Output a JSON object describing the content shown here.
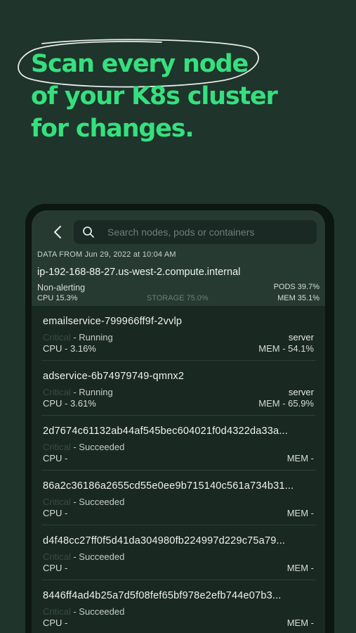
{
  "headline": {
    "line1": "Scan every node",
    "line2": "of your K8s cluster",
    "line3": "for changes."
  },
  "search": {
    "placeholder": "Search nodes, pods or containers"
  },
  "data_from": "DATA FROM Jun 29, 2022 at 10:04 AM",
  "node": {
    "name": "ip-192-168-88-27.us-west-2.compute.internal",
    "state": "Non-alerting",
    "pods": "PODS 39.7%",
    "cpu": "CPU 15.3%",
    "storage": "STORAGE 75.0%",
    "mem": "MEM 35.1%"
  },
  "items": [
    {
      "title": "emailservice-799966ff9f-2vvlp",
      "critical": "Critical",
      "status": " - Running",
      "role": "server",
      "cpu": "CPU - 3.16%",
      "mem": "MEM - 54.1%"
    },
    {
      "title": "adservice-6b74979749-qmnx2",
      "critical": "Critical",
      "status": " - Running",
      "role": "server",
      "cpu": "CPU - 3.61%",
      "mem": "MEM - 65.9%"
    },
    {
      "title": "2d7674c61132ab44af545bec604021f0d4322da33a...",
      "critical": "Critical",
      "status": " - Succeeded",
      "role": "",
      "cpu": "CPU -",
      "mem": "MEM -"
    },
    {
      "title": "86a2c36186a2655cd55e0ee9b715140c561a734b31...",
      "critical": "Critical",
      "status": " - Succeeded",
      "role": "",
      "cpu": "CPU -",
      "mem": "MEM -"
    },
    {
      "title": "d4f48cc27ff0f5d41da304980fb224997d229c75a79...",
      "critical": "Critical",
      "status": " - Succeeded",
      "role": "",
      "cpu": "CPU -",
      "mem": "MEM -"
    },
    {
      "title": "8446ff4ad4b25a7d5f08fef65bf978e2efb744e07b3...",
      "critical": "Critical",
      "status": " - Succeeded",
      "role": "",
      "cpu": "CPU -",
      "mem": "MEM -"
    }
  ],
  "icons": {
    "back": "chevron-left-icon",
    "search": "search-icon"
  },
  "colors": {
    "background": "#1f342b",
    "accent": "#35e07e",
    "panel": "#263a32"
  }
}
